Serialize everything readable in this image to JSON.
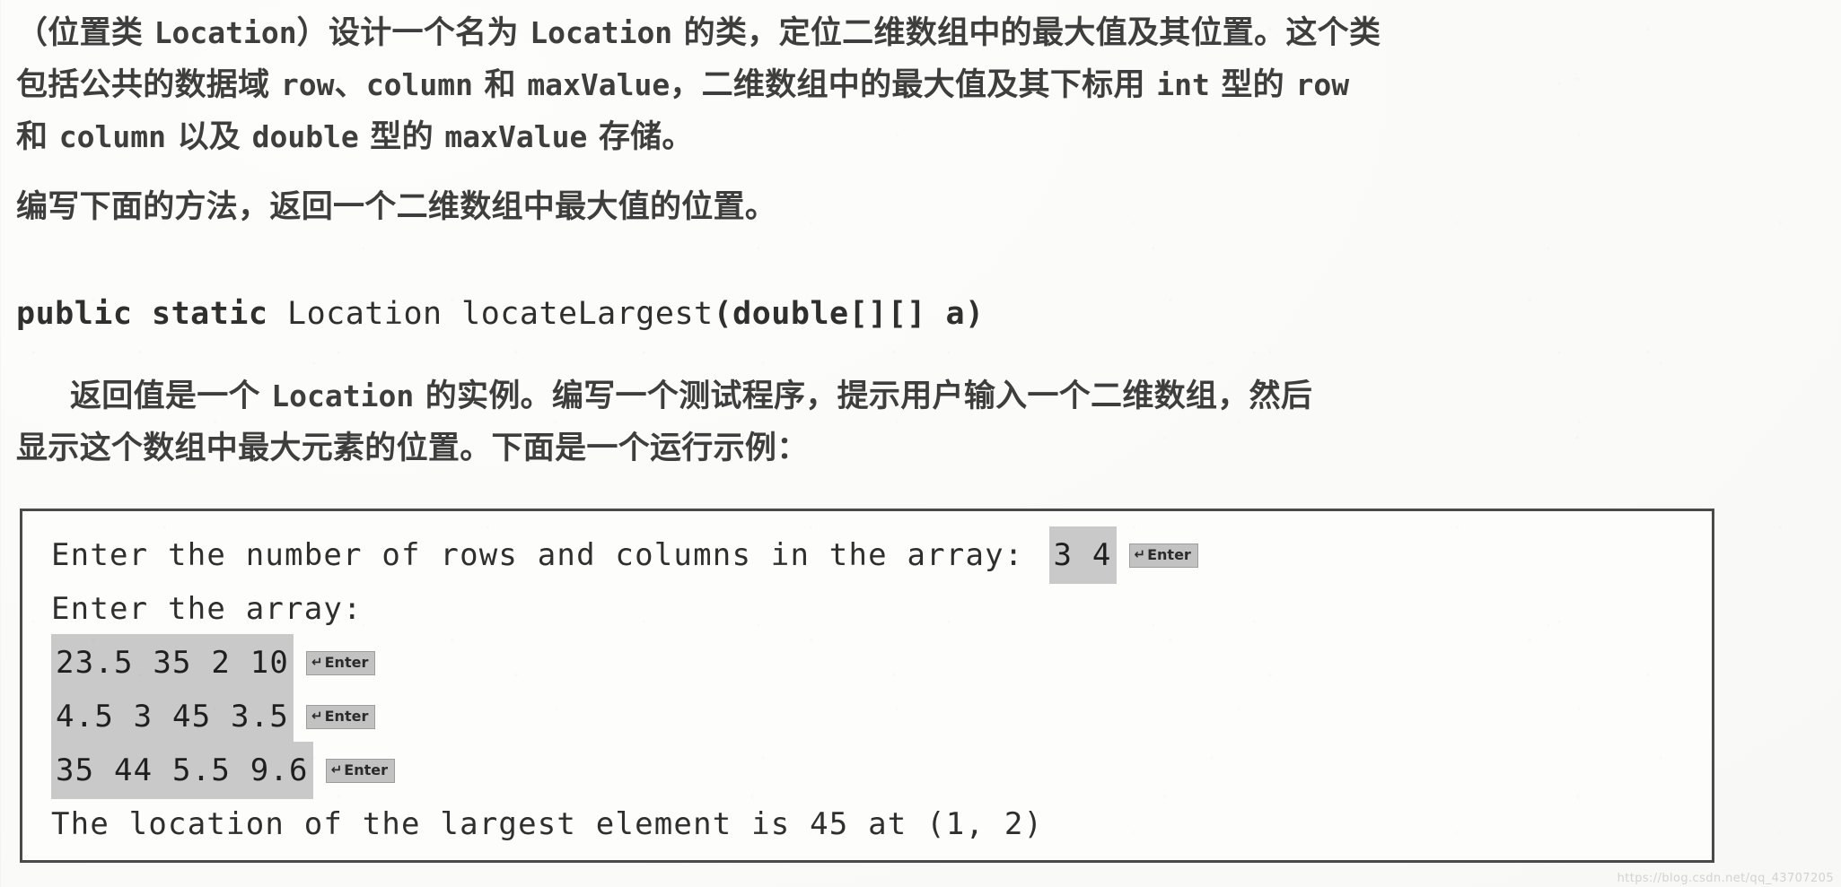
{
  "page": {
    "body_lines": [
      {
        "id": "line-1",
        "segments": [
          {
            "kind": "cjk",
            "text": "（位置类 "
          },
          {
            "kind": "code",
            "text": "Location"
          },
          {
            "kind": "cjk",
            "text": "）设计一个名为 "
          },
          {
            "kind": "code",
            "text": "Location"
          },
          {
            "kind": "cjk",
            "text": " 的类，定位二维数组中的最大值及其位置。这个类"
          }
        ]
      },
      {
        "id": "line-2",
        "segments": [
          {
            "kind": "cjk",
            "text": "包括公共的数据域 "
          },
          {
            "kind": "code",
            "text": "row"
          },
          {
            "kind": "cjk",
            "text": "、"
          },
          {
            "kind": "code",
            "text": "column"
          },
          {
            "kind": "cjk",
            "text": " 和 "
          },
          {
            "kind": "code",
            "text": "maxValue"
          },
          {
            "kind": "cjk",
            "text": "，二维数组中的最大值及其下标用 "
          },
          {
            "kind": "code",
            "text": "int"
          },
          {
            "kind": "cjk",
            "text": " 型的 "
          },
          {
            "kind": "code",
            "text": "row"
          }
        ]
      },
      {
        "id": "line-3",
        "segments": [
          {
            "kind": "cjk",
            "text": "和 "
          },
          {
            "kind": "code",
            "text": "column"
          },
          {
            "kind": "cjk",
            "text": " 以及 "
          },
          {
            "kind": "code",
            "text": "double"
          },
          {
            "kind": "cjk",
            "text": " 型的 "
          },
          {
            "kind": "code",
            "text": "maxValue"
          },
          {
            "kind": "cjk",
            "text": " 存储。"
          }
        ]
      },
      {
        "id": "line-4",
        "segments": [
          {
            "kind": "cjk",
            "text": "编写下面的方法，返回一个二维数组中最大值的位置。"
          }
        ]
      }
    ],
    "method_signature": {
      "modifiers": "public static",
      "return_type": " Location ",
      "method_name": "locateLargest",
      "params": "(double[][] a)",
      "full_text": "public static Location locateLargest(double[][] a)"
    },
    "body_lines_after": [
      {
        "id": "line-5",
        "indent": true,
        "segments": [
          {
            "kind": "cjk",
            "text": "返回值是一个 "
          },
          {
            "kind": "code",
            "text": "Location"
          },
          {
            "kind": "cjk",
            "text": " 的实例。编写一个测试程序，提示用户输入一个二维数组，然后"
          }
        ]
      },
      {
        "id": "line-6",
        "indent": false,
        "segments": [
          {
            "kind": "cjk",
            "text": "显示这个数组中最大元素的位置。下面是一个运行示例："
          }
        ]
      }
    ]
  },
  "console": {
    "lines": [
      {
        "id": "console-line-1",
        "parts": [
          {
            "type": "text",
            "value": "Enter the number of rows and columns in the array:"
          },
          {
            "type": "gap"
          },
          {
            "type": "highlight",
            "value": "3 4"
          },
          {
            "type": "enter-key",
            "value": "Enter"
          }
        ]
      },
      {
        "id": "console-line-2",
        "parts": [
          {
            "type": "text",
            "value": "Enter the array:"
          }
        ]
      },
      {
        "id": "console-line-3",
        "parts": [
          {
            "type": "highlight",
            "value": "23.5 35 2 10"
          },
          {
            "type": "enter-key",
            "value": "Enter"
          }
        ]
      },
      {
        "id": "console-line-4",
        "parts": [
          {
            "type": "highlight",
            "value": "4.5 3 45 3.5"
          },
          {
            "type": "enter-key",
            "value": "Enter"
          }
        ]
      },
      {
        "id": "console-line-5",
        "parts": [
          {
            "type": "highlight",
            "value": "35 44 5.5 9.6"
          },
          {
            "type": "enter-key",
            "value": "Enter"
          }
        ]
      },
      {
        "id": "console-line-6",
        "parts": [
          {
            "type": "text",
            "value": "The location of the largest element is 45 at (1, 2)"
          }
        ]
      }
    ],
    "enter_key_label": "Enter",
    "enter_key_glyph": "↵"
  },
  "watermark": {
    "text": "https://blog.csdn.net/qq_43707205"
  },
  "colors": {
    "ink": "#3e3e3e",
    "code_ink": "#2f2f2f",
    "highlight_bg": "#c9c9c9",
    "box_border": "#4a4a4a",
    "paper": "#fdfdfc"
  }
}
